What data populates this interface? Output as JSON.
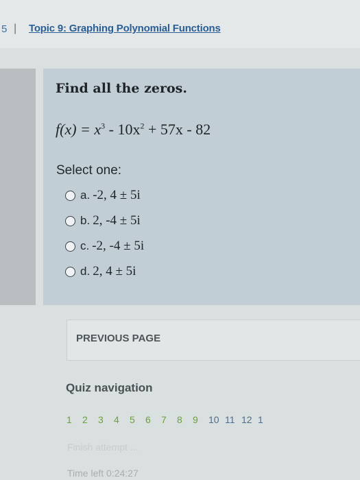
{
  "header": {
    "prev_fragment": "5",
    "separator": "|",
    "breadcrumb": "Topic 9: Graphing Polynomial Functions"
  },
  "question": {
    "heading": "Find all the zeros.",
    "formula": {
      "lhs": "f(x) = ",
      "t1": "x",
      "t1_exp": "3",
      "t2": " - 10x",
      "t2_exp": "2",
      "t3": " + 57x - 82"
    },
    "select_label": "Select one:",
    "options": [
      {
        "letter": "a.",
        "value": "-2, 4 ± 5i"
      },
      {
        "letter": "b.",
        "value": "2, -4 ± 5i"
      },
      {
        "letter": "c.",
        "value": "-2, -4 ± 5i"
      },
      {
        "letter": "d.",
        "value": "2, 4 ± 5i"
      }
    ]
  },
  "navigation": {
    "previous_page": "PREVIOUS PAGE",
    "quiz_nav_title": "Quiz navigation",
    "numbers": [
      "1",
      "2",
      "3",
      "4",
      "5",
      "6",
      "7",
      "8",
      "9",
      "10",
      "11",
      "12",
      "1"
    ],
    "finish_attempt": "Finish attempt ...",
    "time_left": "Time left 0:24:27"
  },
  "colors": {
    "card": "#c2ced6",
    "breadcrumb_link": "#2b5e95",
    "nav_answered": "#6aa13a"
  }
}
